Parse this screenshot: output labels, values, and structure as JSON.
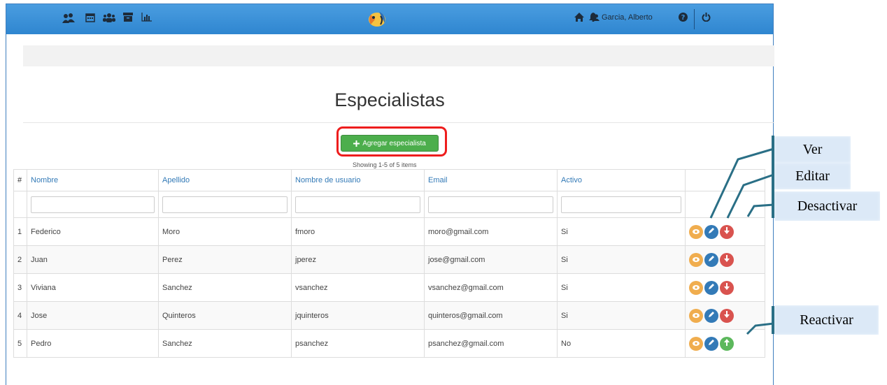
{
  "navbar": {
    "left_icons": [
      "users-cluster-icon",
      "calendar-icon",
      "group-icon",
      "archive-icon",
      "bar-chart-icon"
    ],
    "right_icons": [
      "home-icon",
      "bell-icon",
      "user-icon",
      "question-icon",
      "power-icon"
    ],
    "user_name": "Garcia, Alberto",
    "logo": "fish-logo"
  },
  "page": {
    "title": "Especialistas",
    "add_button_label": "Agregar especialista",
    "showing_text": "Showing 1-5 of 5 items"
  },
  "table": {
    "columns": [
      "#",
      "Nombre",
      "Apellido",
      "Nombre de usuario",
      "Email",
      "Activo"
    ],
    "rows": [
      {
        "num": "1",
        "nombre": "Federico",
        "apellido": "Moro",
        "usuario": "fmoro",
        "email": "moro@gmail.com",
        "activo": "Si",
        "third_action": "desactivar"
      },
      {
        "num": "2",
        "nombre": "Juan",
        "apellido": "Perez",
        "usuario": "jperez",
        "email": "jose@gmail.com",
        "activo": "Si",
        "third_action": "desactivar"
      },
      {
        "num": "3",
        "nombre": "Viviana",
        "apellido": "Sanchez",
        "usuario": "vsanchez",
        "email": "vsanchez@gmail.com",
        "activo": "Si",
        "third_action": "desactivar"
      },
      {
        "num": "4",
        "nombre": "Jose",
        "apellido": "Quinteros",
        "usuario": "jquinteros",
        "email": "quinteros@gmail.com",
        "activo": "Si",
        "third_action": "desactivar"
      },
      {
        "num": "5",
        "nombre": "Pedro",
        "apellido": "Sanchez",
        "usuario": "psanchez",
        "email": "psanchez@gmail.com",
        "activo": "No",
        "third_action": "reactivar"
      }
    ]
  },
  "callouts": {
    "ver": "Ver",
    "editar": "Editar",
    "desactivar": "Desactivar",
    "reactivar": "Reactivar"
  },
  "colors": {
    "navbar": "#3a8fd6",
    "highlight_outline": "#ee1d1d",
    "add_button": "#4cae4c",
    "view": "#f0ad4e",
    "edit": "#337ab7",
    "deactivate": "#d9534f",
    "reactivate": "#5cb85c",
    "callout_bg": "#dce9f7",
    "leader_line": "#2a6f86"
  }
}
